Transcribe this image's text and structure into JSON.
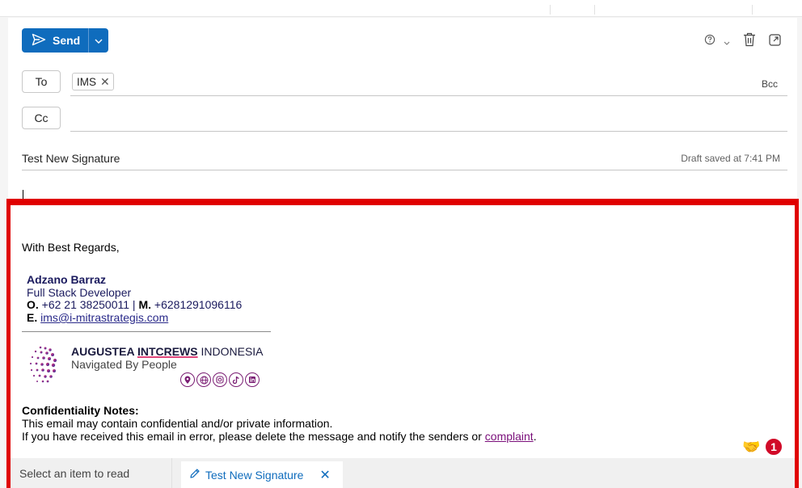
{
  "toolbar": {
    "send_label": "Send"
  },
  "recipients": {
    "to_label": "To",
    "to_chip": "IMS",
    "cc_label": "Cc",
    "bcc_label": "Bcc"
  },
  "subject": {
    "text": "Test New Signature",
    "draft_status": "Draft saved at 7:41 PM"
  },
  "signature": {
    "greeting": "With Best Regards,",
    "name": "Adzano Barraz",
    "title": "Full Stack Developer",
    "office_prefix": "O.",
    "office_phone": "+62 21 38250011",
    "separator": "|",
    "mobile_prefix": "M.",
    "mobile_phone": "+6281291096116",
    "email_prefix": "E.",
    "email": "ims@i-mitrastrategis.com",
    "company_part1": "AUGUSTEA",
    "company_part2": "INTCREWS",
    "company_part3": "INDONESIA",
    "tagline": "Navigated By People",
    "social_icons": [
      "location-icon",
      "globe-icon",
      "instagram-icon",
      "tiktok-icon",
      "linkedin-icon"
    ],
    "confidentiality_heading": "Confidentiality Notes:",
    "confidentiality_line1": "This email may contain confidential and/or private information.",
    "confidentiality_line2_pre": "If you have received this email in error, please delete the message and notify the senders or",
    "confidentiality_link": "complaint",
    "confidentiality_line2_post": "."
  },
  "notification": {
    "count": "1"
  },
  "tabs": {
    "reading_pane": "Select an item to read",
    "active_draft": "Test New Signature"
  },
  "colors": {
    "accent": "#0f6cbd",
    "highlight": "#e00000",
    "badge": "#d10a28",
    "social": "#7a1d73"
  }
}
